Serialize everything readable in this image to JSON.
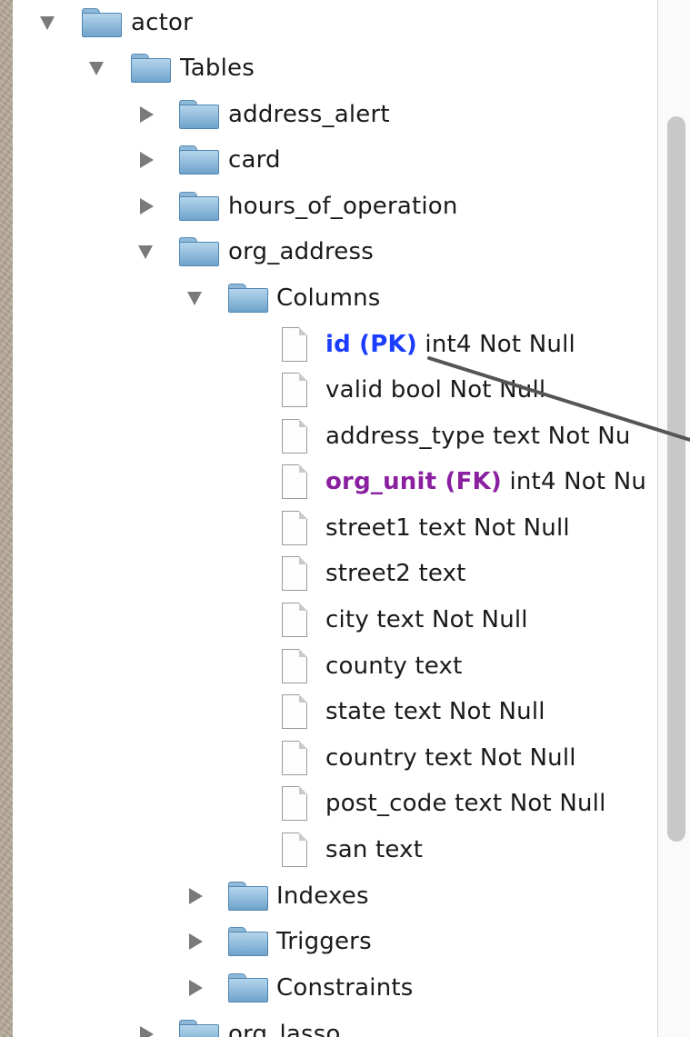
{
  "tree": {
    "root": {
      "label": "actor",
      "expanded": true
    },
    "tables_folder": {
      "label": "Tables",
      "expanded": true
    },
    "tables": [
      {
        "label": "address_alert",
        "expanded": false
      },
      {
        "label": "card",
        "expanded": false
      },
      {
        "label": "hours_of_operation",
        "expanded": false
      },
      {
        "label": "org_address",
        "expanded": true
      }
    ],
    "columns_folder": {
      "label": "Columns",
      "expanded": true
    },
    "columns": [
      {
        "name": "id (PK)",
        "key": "pk",
        "detail": " int4 Not Null"
      },
      {
        "name": "",
        "key": "",
        "detail": "valid bool Not Null"
      },
      {
        "name": "",
        "key": "",
        "detail": "address_type text Not Nu"
      },
      {
        "name": "org_unit (FK)",
        "key": "fk",
        "detail": " int4 Not Nu"
      },
      {
        "name": "",
        "key": "",
        "detail": "street1 text Not Null"
      },
      {
        "name": "",
        "key": "",
        "detail": "street2 text"
      },
      {
        "name": "",
        "key": "",
        "detail": "city text Not Null"
      },
      {
        "name": "",
        "key": "",
        "detail": "county text"
      },
      {
        "name": "",
        "key": "",
        "detail": "state text Not Null"
      },
      {
        "name": "",
        "key": "",
        "detail": "country text Not Null"
      },
      {
        "name": "",
        "key": "",
        "detail": "post_code text Not Null"
      },
      {
        "name": "",
        "key": "",
        "detail": "san text"
      }
    ],
    "subfolders": [
      {
        "label": "Indexes",
        "expanded": false
      },
      {
        "label": "Triggers",
        "expanded": false
      },
      {
        "label": "Constraints",
        "expanded": false
      }
    ],
    "next_table": {
      "label": "org_lasso",
      "expanded": false
    }
  },
  "colors": {
    "pk": "#1a3dff",
    "fk": "#8a1fa0",
    "text": "#1a1a1a",
    "folder": "#6fa3cc"
  },
  "icons": {
    "folder": "folder-icon",
    "column": "document-icon",
    "expanded": "disclosure-triangle-down-icon",
    "collapsed": "disclosure-triangle-right-icon"
  }
}
